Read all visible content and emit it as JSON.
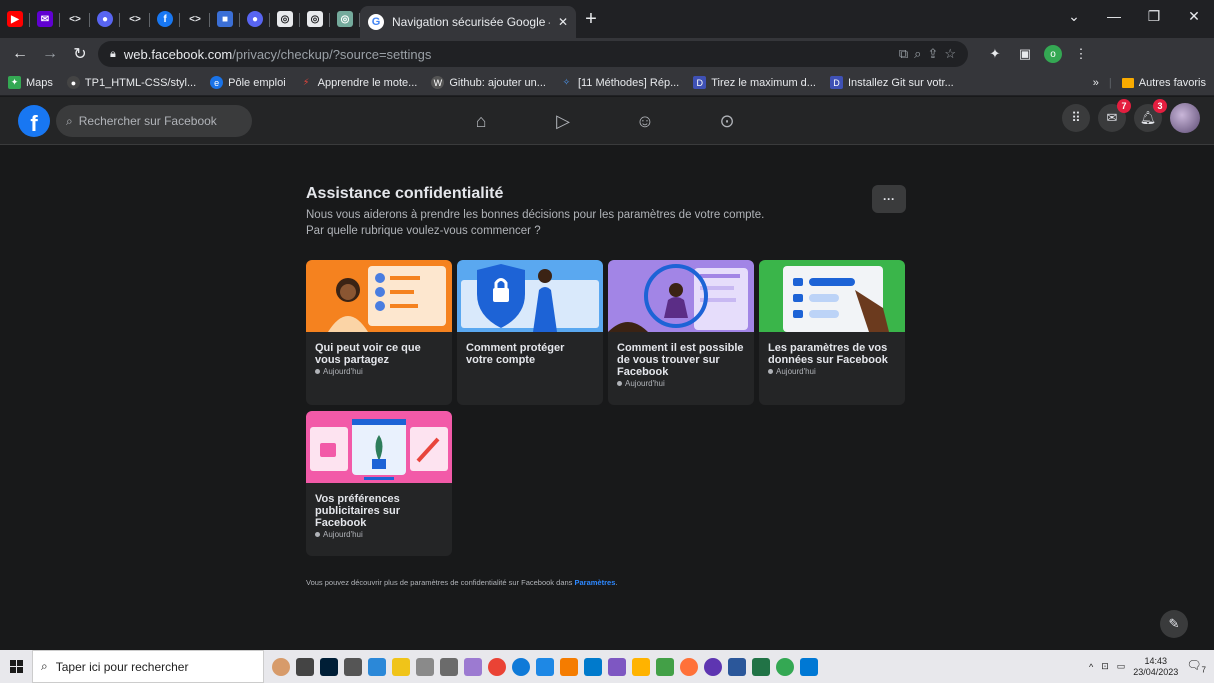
{
  "browser": {
    "active_tab_title": "Navigation sécurisée Google – G",
    "url_domain": "web.facebook.com",
    "url_path": "/privacy/checkup/?source=settings",
    "profile_letter": "o",
    "bookmarks": [
      {
        "label": "Maps",
        "color": "#34a853"
      },
      {
        "label": "TP1_HTML-CSS/styl...",
        "color": "#444444"
      },
      {
        "label": "Pôle emploi",
        "color": "#1a73e8"
      },
      {
        "label": "Apprendre le mote...",
        "color": "#e8453c"
      },
      {
        "label": "Github: ajouter un...",
        "color": "#555555"
      },
      {
        "label": "[11 Méthodes] Rép...",
        "color": "#4f9cf9"
      },
      {
        "label": "Tirez le maximum d...",
        "color": "#3f51b5"
      },
      {
        "label": "Installez Git sur votr...",
        "color": "#3f51b5"
      }
    ],
    "bookmarks_overflow": "»",
    "other_bookmarks": "Autres favoris"
  },
  "facebook": {
    "logo": "f",
    "search_placeholder": "Rechercher sur Facebook",
    "messenger_badge": "7",
    "notifications_badge": "3"
  },
  "page": {
    "title": "Assistance confidentialité",
    "subtitle_1": "Nous vous aiderons à prendre les bonnes décisions pour les paramètres de votre compte.",
    "subtitle_2": "Par quelle rubrique voulez-vous commencer ?",
    "more_label": "···",
    "cards": [
      {
        "title": "Qui peut voir ce que vous partagez",
        "date": "Aujourd'hui",
        "color": "#f5821f"
      },
      {
        "title": "Comment protéger votre compte",
        "date": "",
        "color": "#5aa8f0"
      },
      {
        "title": "Comment il est possible de vous trouver sur Facebook",
        "date": "Aujourd'hui",
        "color": "#a285e6"
      },
      {
        "title": "Les paramètres de vos données sur Facebook",
        "date": "Aujourd'hui",
        "color": "#3ab54a"
      },
      {
        "title": "Vos préférences publicitaires sur Facebook",
        "date": "Aujourd'hui",
        "color": "#f25aa8"
      }
    ],
    "footer_text": "Vous pouvez découvrir plus de paramètres de confidentialité sur Facebook dans ",
    "footer_link": "Paramètres",
    "footer_end": "."
  },
  "taskbar": {
    "search_placeholder": "Taper ici pour rechercher",
    "time": "14:43",
    "date": "23/04/2023",
    "notif_count": "7"
  }
}
